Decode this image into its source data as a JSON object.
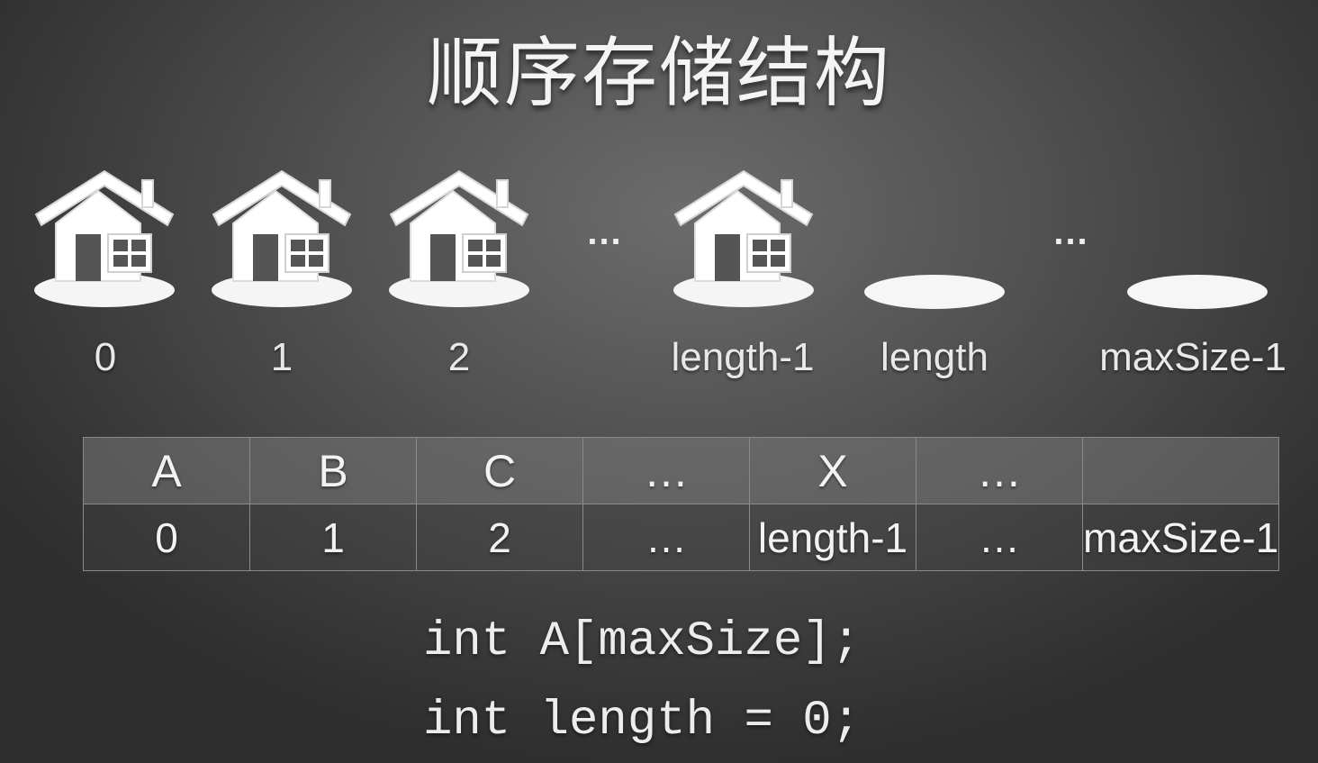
{
  "title": "顺序存储结构",
  "slots": [
    {
      "kind": "house",
      "label": "0"
    },
    {
      "kind": "house",
      "label": "1"
    },
    {
      "kind": "house",
      "label": "2"
    },
    {
      "kind": "dots",
      "label": "..."
    },
    {
      "kind": "house",
      "label": "length-1"
    },
    {
      "kind": "plate",
      "label": "length"
    },
    {
      "kind": "dots",
      "label": "..."
    },
    {
      "kind": "plate",
      "label": "maxSize-1"
    }
  ],
  "table": {
    "values": [
      "A",
      "B",
      "C",
      "…",
      "X",
      "…",
      ""
    ],
    "indices": [
      "0",
      "1",
      "2",
      "…",
      "length-1",
      "…",
      "maxSize-1"
    ]
  },
  "code": {
    "line1": "int A[maxSize];",
    "line2": "int length = 0;"
  },
  "colors": {
    "house": "#ffffff",
    "plate": "#f4f4f4",
    "background": "#4a4a4a"
  }
}
